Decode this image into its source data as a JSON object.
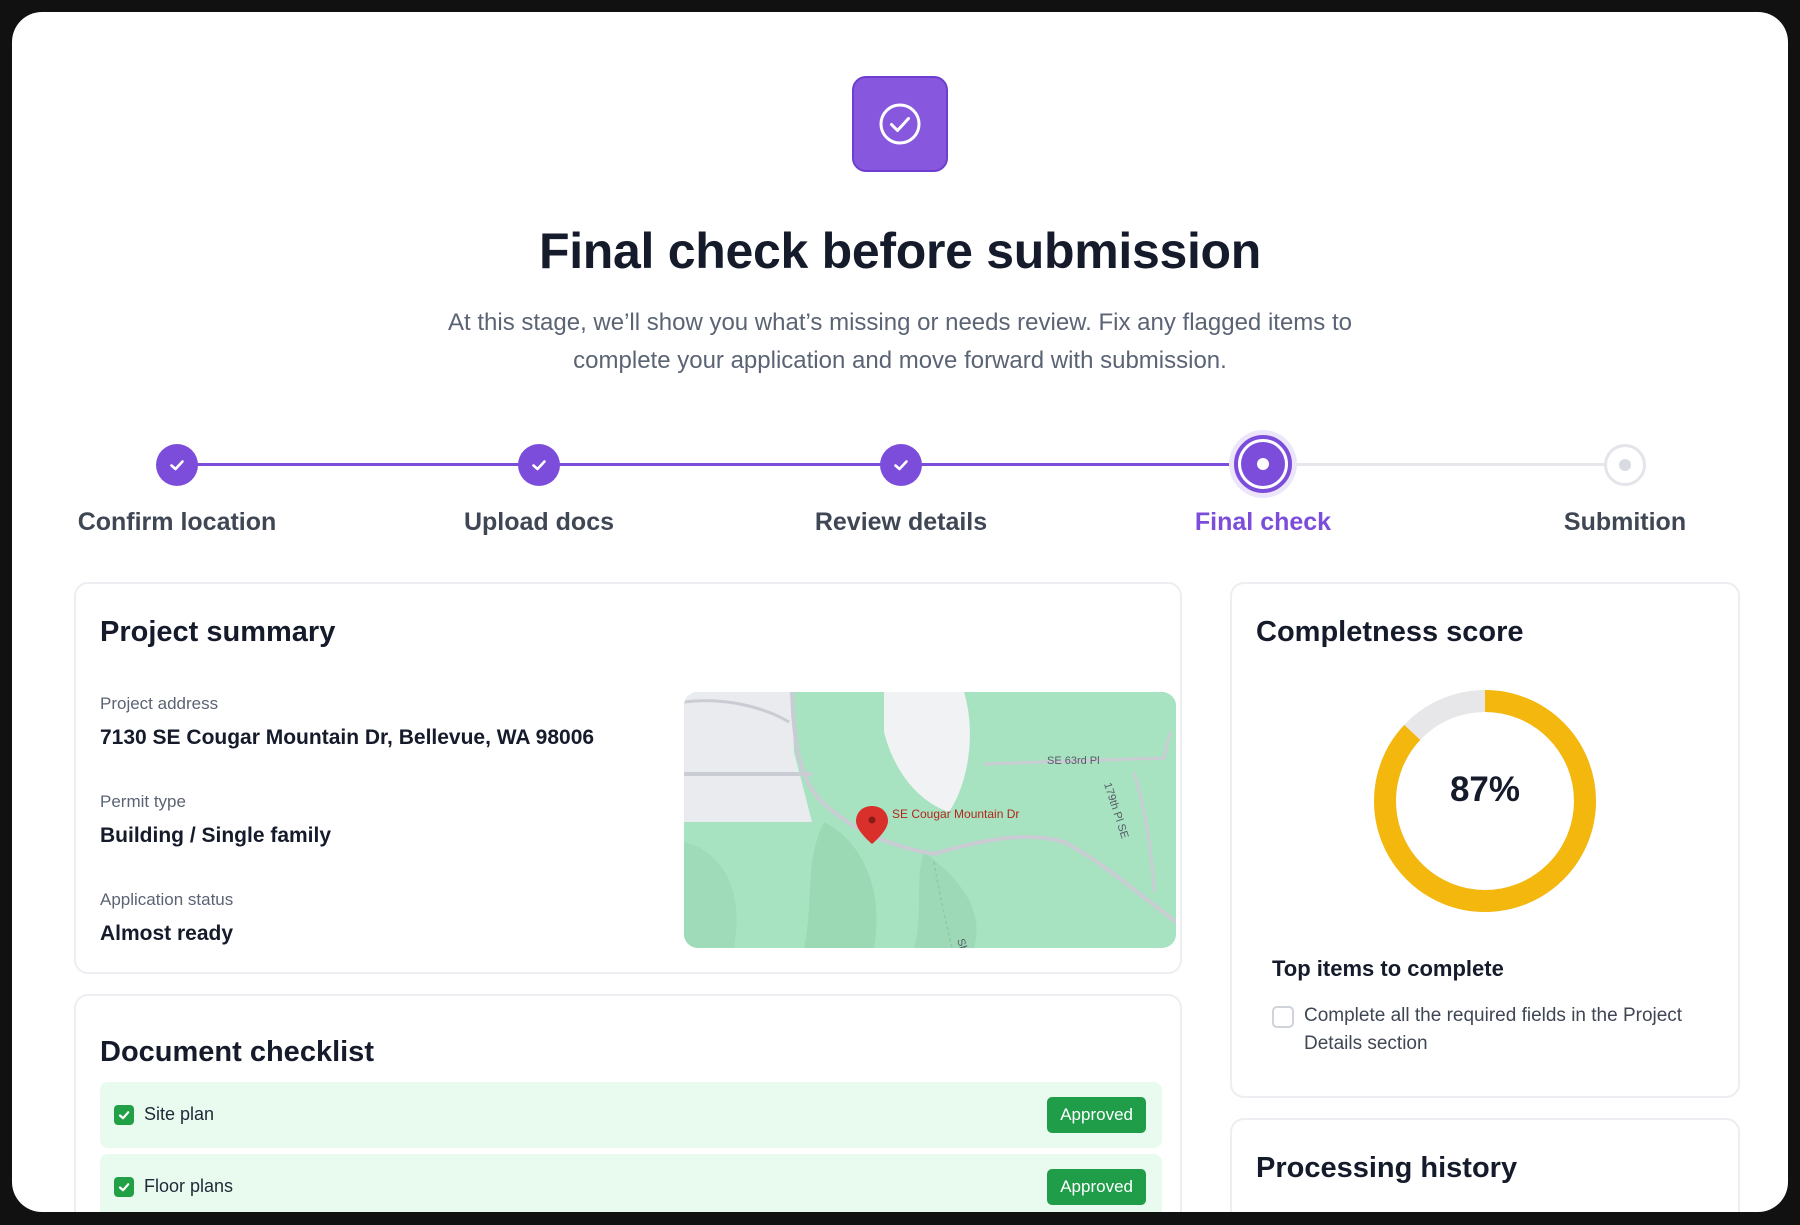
{
  "header": {
    "icon": "check-circle-icon",
    "title": "Final check before submission",
    "subtitle": "At this stage, we’ll show you what’s missing or needs review. Fix any flagged items to complete your application and move forward with submission."
  },
  "stepper": {
    "steps": [
      {
        "label": "Confirm location",
        "status": "done"
      },
      {
        "label": "Upload docs",
        "status": "done"
      },
      {
        "label": "Review details",
        "status": "done"
      },
      {
        "label": "Final check",
        "status": "active"
      },
      {
        "label": "Submition",
        "status": "pending"
      }
    ]
  },
  "summary": {
    "title": "Project summary",
    "address_label": "Project address",
    "address": "7130 SE Cougar Mountain Dr, Bellevue, WA 98006",
    "permit_label": "Permit type",
    "permit": "Building / Single family",
    "status_label": "Application status",
    "status": "Almost ready",
    "map": {
      "pin_label": "SE Cougar Mountain Dr",
      "street_1": "SE 63rd Pl",
      "street_2": "179th Pl SE",
      "street_3": "Sh"
    }
  },
  "checklist": {
    "title": "Document checklist",
    "items": [
      {
        "name": "Site plan",
        "status": "Approved"
      },
      {
        "name": "Floor plans",
        "status": "Approved"
      }
    ]
  },
  "score": {
    "title": "Completness score",
    "value": "87%",
    "percent": 87,
    "top_items_title": "Top items to complete",
    "todo": "Complete all the required fields in the Project Details section"
  },
  "history": {
    "title": "Processing history"
  },
  "colors": {
    "accent": "#7c4ddb",
    "score": "#f4b70e",
    "approved": "#1f9d49"
  }
}
